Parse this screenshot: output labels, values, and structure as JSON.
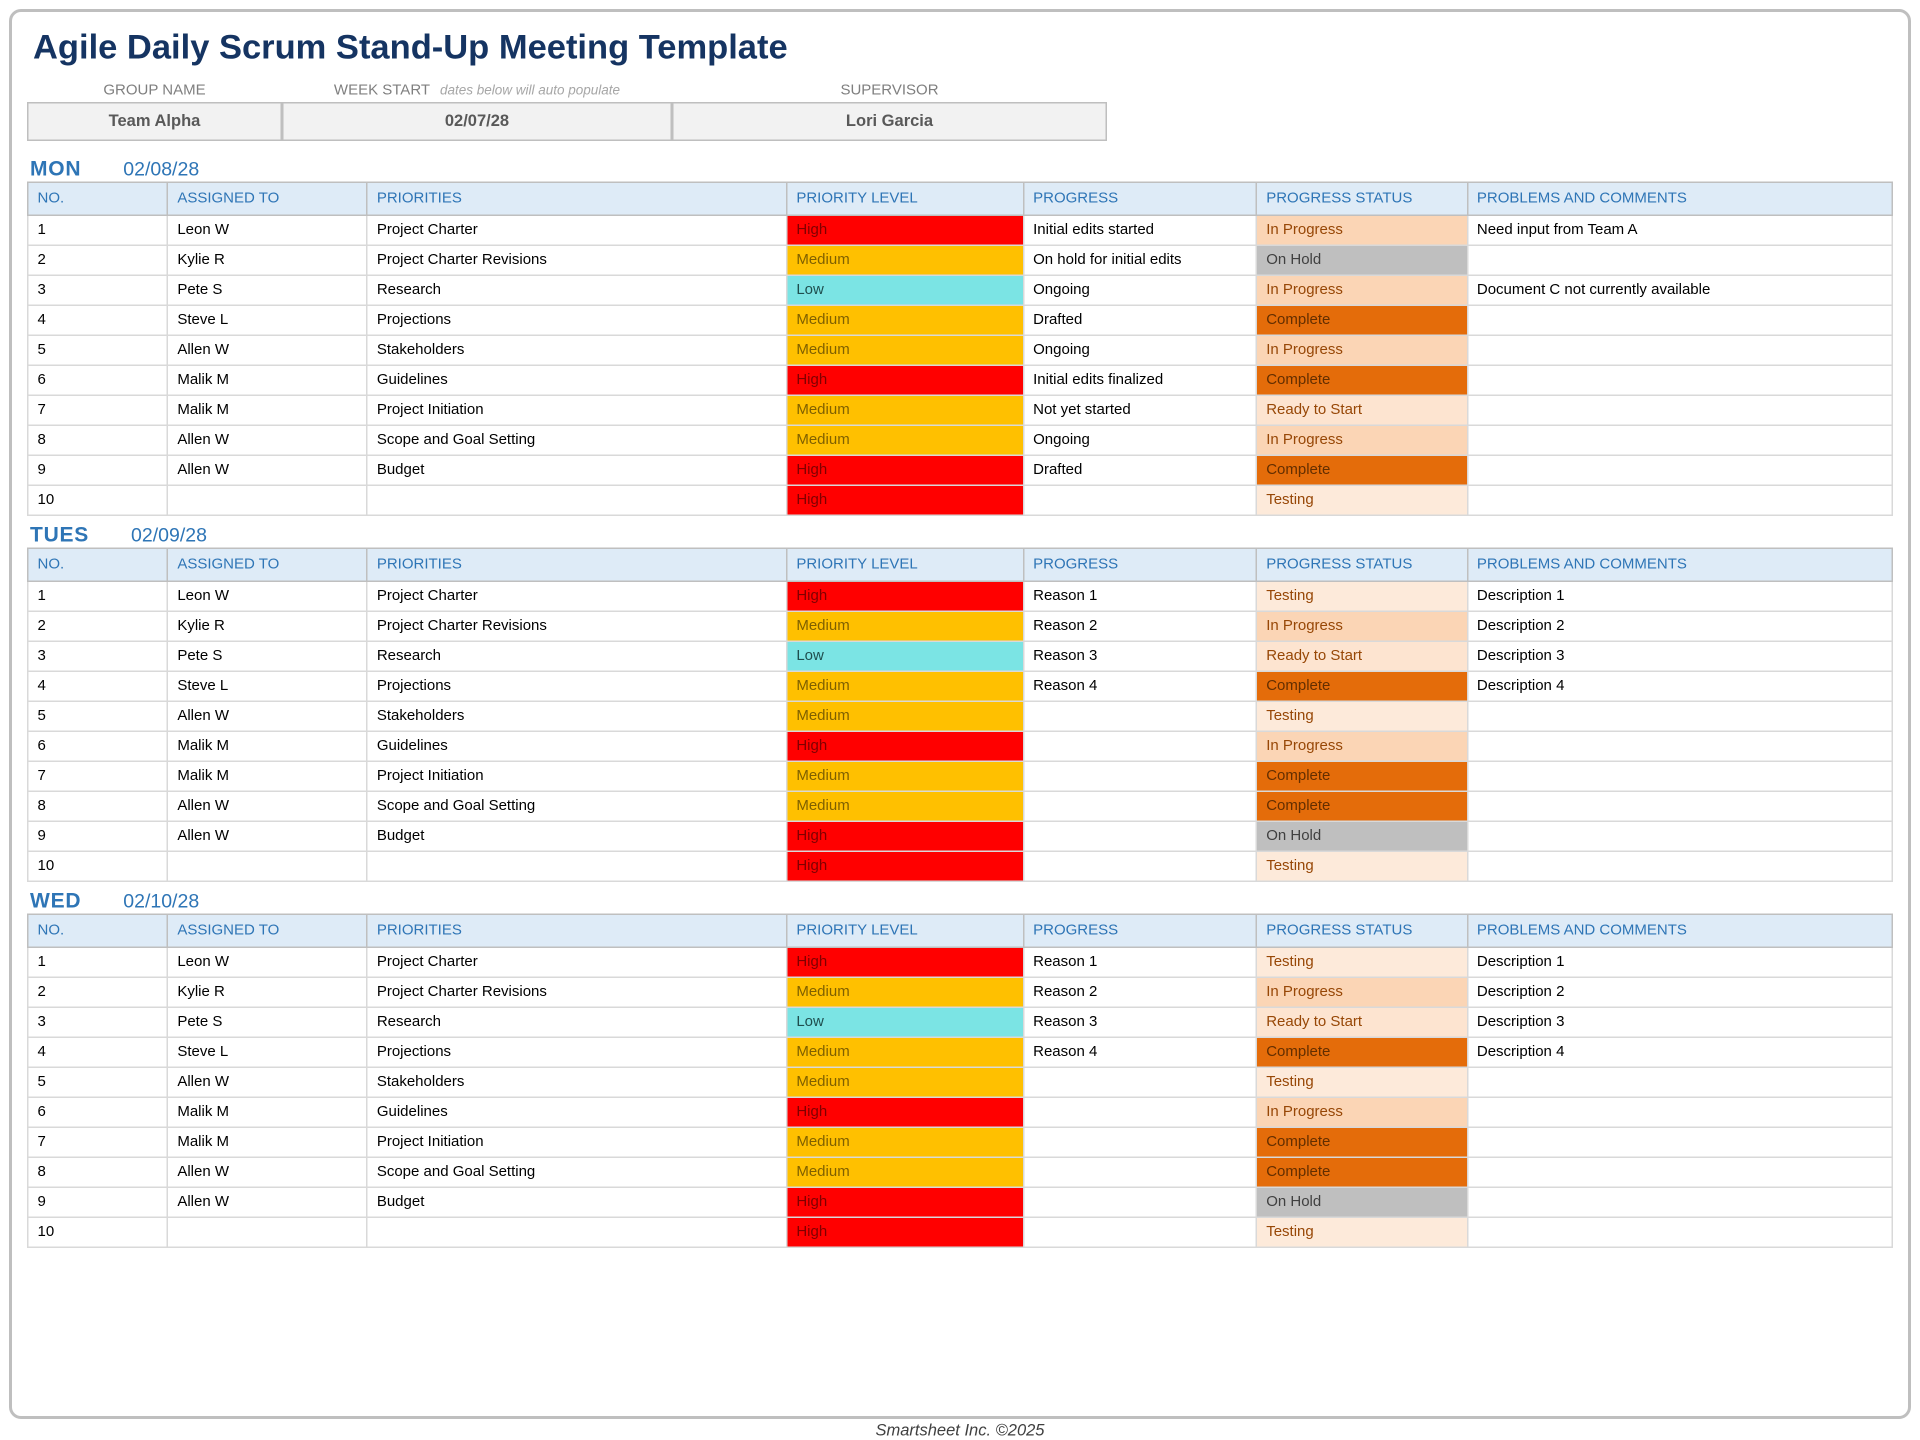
{
  "title": "Agile Daily Scrum Stand-Up Meeting Template",
  "meta": {
    "labels": {
      "group": "GROUP NAME",
      "week": "WEEK START",
      "week_hint": "dates below will auto populate",
      "supervisor": "SUPERVISOR"
    },
    "values": {
      "group": "Team Alpha",
      "week": "02/07/28",
      "supervisor": "Lori Garcia"
    }
  },
  "headers": {
    "no": "NO.",
    "assigned": "ASSIGNED TO",
    "priorities": "PRIORITIES",
    "plevel": "PRIORITY LEVEL",
    "progress": "PROGRESS",
    "pstatus": "PROGRESS STATUS",
    "comments": "PROBLEMS AND COMMENTS"
  },
  "days": [
    {
      "day": "MON",
      "date": "02/08/28",
      "rows": [
        {
          "no": "1",
          "assigned": "Leon W",
          "pri": "Project Charter",
          "plvl": "High",
          "prog": "Initial edits started",
          "pstat": "In Progress",
          "comm": "Need input from Team A"
        },
        {
          "no": "2",
          "assigned": "Kylie R",
          "pri": "Project Charter Revisions",
          "plvl": "Medium",
          "prog": "On hold for initial edits",
          "pstat": "On Hold",
          "comm": ""
        },
        {
          "no": "3",
          "assigned": "Pete S",
          "pri": "Research",
          "plvl": "Low",
          "prog": "Ongoing",
          "pstat": "In Progress",
          "comm": "Document C not currently available"
        },
        {
          "no": "4",
          "assigned": "Steve L",
          "pri": "Projections",
          "plvl": "Medium",
          "prog": "Drafted",
          "pstat": "Complete",
          "comm": ""
        },
        {
          "no": "5",
          "assigned": "Allen W",
          "pri": "Stakeholders",
          "plvl": "Medium",
          "prog": "Ongoing",
          "pstat": "In Progress",
          "comm": ""
        },
        {
          "no": "6",
          "assigned": "Malik M",
          "pri": "Guidelines",
          "plvl": "High",
          "prog": "Initial edits finalized",
          "pstat": "Complete",
          "comm": ""
        },
        {
          "no": "7",
          "assigned": "Malik M",
          "pri": "Project Initiation",
          "plvl": "Medium",
          "prog": "Not yet started",
          "pstat": "Ready to Start",
          "comm": ""
        },
        {
          "no": "8",
          "assigned": "Allen W",
          "pri": "Scope and Goal Setting",
          "plvl": "Medium",
          "prog": "Ongoing",
          "pstat": "In Progress",
          "comm": ""
        },
        {
          "no": "9",
          "assigned": "Allen W",
          "pri": "Budget",
          "plvl": "High",
          "prog": "Drafted",
          "pstat": "Complete",
          "comm": ""
        },
        {
          "no": "10",
          "assigned": "",
          "pri": "",
          "plvl": "High",
          "prog": "",
          "pstat": "Testing",
          "comm": ""
        }
      ]
    },
    {
      "day": "TUES",
      "date": "02/09/28",
      "rows": [
        {
          "no": "1",
          "assigned": "Leon W",
          "pri": "Project Charter",
          "plvl": "High",
          "prog": "Reason 1",
          "pstat": "Testing",
          "comm": "Description 1"
        },
        {
          "no": "2",
          "assigned": "Kylie R",
          "pri": "Project Charter Revisions",
          "plvl": "Medium",
          "prog": "Reason 2",
          "pstat": "In Progress",
          "comm": "Description 2"
        },
        {
          "no": "3",
          "assigned": "Pete S",
          "pri": "Research",
          "plvl": "Low",
          "prog": "Reason 3",
          "pstat": "Ready to Start",
          "comm": "Description 3"
        },
        {
          "no": "4",
          "assigned": "Steve L",
          "pri": "Projections",
          "plvl": "Medium",
          "prog": "Reason 4",
          "pstat": "Complete",
          "comm": "Description 4"
        },
        {
          "no": "5",
          "assigned": "Allen W",
          "pri": "Stakeholders",
          "plvl": "Medium",
          "prog": "",
          "pstat": "Testing",
          "comm": ""
        },
        {
          "no": "6",
          "assigned": "Malik M",
          "pri": "Guidelines",
          "plvl": "High",
          "prog": "",
          "pstat": "In Progress",
          "comm": ""
        },
        {
          "no": "7",
          "assigned": "Malik M",
          "pri": "Project Initiation",
          "plvl": "Medium",
          "prog": "",
          "pstat": "Complete",
          "comm": ""
        },
        {
          "no": "8",
          "assigned": "Allen W",
          "pri": "Scope and Goal Setting",
          "plvl": "Medium",
          "prog": "",
          "pstat": "Complete",
          "comm": ""
        },
        {
          "no": "9",
          "assigned": "Allen W",
          "pri": "Budget",
          "plvl": "High",
          "prog": "",
          "pstat": "On Hold",
          "comm": ""
        },
        {
          "no": "10",
          "assigned": "",
          "pri": "",
          "plvl": "High",
          "prog": "",
          "pstat": "Testing",
          "comm": ""
        }
      ]
    },
    {
      "day": "WED",
      "date": "02/10/28",
      "rows": [
        {
          "no": "1",
          "assigned": "Leon W",
          "pri": "Project Charter",
          "plvl": "High",
          "prog": "Reason 1",
          "pstat": "Testing",
          "comm": "Description 1"
        },
        {
          "no": "2",
          "assigned": "Kylie R",
          "pri": "Project Charter Revisions",
          "plvl": "Medium",
          "prog": "Reason 2",
          "pstat": "In Progress",
          "comm": "Description 2"
        },
        {
          "no": "3",
          "assigned": "Pete S",
          "pri": "Research",
          "plvl": "Low",
          "prog": "Reason 3",
          "pstat": "Ready to Start",
          "comm": "Description 3"
        },
        {
          "no": "4",
          "assigned": "Steve L",
          "pri": "Projections",
          "plvl": "Medium",
          "prog": "Reason 4",
          "pstat": "Complete",
          "comm": "Description 4"
        },
        {
          "no": "5",
          "assigned": "Allen W",
          "pri": "Stakeholders",
          "plvl": "Medium",
          "prog": "",
          "pstat": "Testing",
          "comm": ""
        },
        {
          "no": "6",
          "assigned": "Malik M",
          "pri": "Guidelines",
          "plvl": "High",
          "prog": "",
          "pstat": "In Progress",
          "comm": ""
        },
        {
          "no": "7",
          "assigned": "Malik M",
          "pri": "Project Initiation",
          "plvl": "Medium",
          "prog": "",
          "pstat": "Complete",
          "comm": ""
        },
        {
          "no": "8",
          "assigned": "Allen W",
          "pri": "Scope and Goal Setting",
          "plvl": "Medium",
          "prog": "",
          "pstat": "Complete",
          "comm": ""
        },
        {
          "no": "9",
          "assigned": "Allen W",
          "pri": "Budget",
          "plvl": "High",
          "prog": "",
          "pstat": "On Hold",
          "comm": ""
        },
        {
          "no": "10",
          "assigned": "",
          "pri": "",
          "plvl": "High",
          "prog": "",
          "pstat": "Testing",
          "comm": ""
        }
      ]
    }
  ],
  "footer": "Smartsheet Inc. ©2025"
}
